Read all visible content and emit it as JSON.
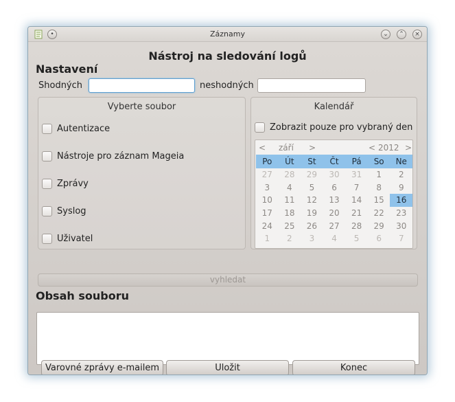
{
  "window": {
    "title": "Záznamy"
  },
  "main": {
    "heading": "Nástroj na sledování logů",
    "settings_title": "Nastavení",
    "match_label": "Shodných",
    "match_value": "",
    "nomatch_label": "neshodných",
    "nomatch_value": ""
  },
  "file_group": {
    "title": "Vyberte soubor",
    "items": [
      {
        "label": "Autentizace"
      },
      {
        "label": "Nástroje pro záznam Mageia"
      },
      {
        "label": "Zprávy"
      },
      {
        "label": "Syslog"
      },
      {
        "label": "Uživatel"
      }
    ]
  },
  "calendar_group": {
    "title": "Kalendář",
    "only_selected_label": "Zobrazit pouze pro vybraný den",
    "month": "září",
    "year": "2012",
    "prev": "<",
    "next": ">",
    "weekdays": [
      "Po",
      "Út",
      "St",
      "Čt",
      "Pá",
      "So",
      "Ne"
    ],
    "weeks": [
      [
        "27",
        "28",
        "29",
        "30",
        "31",
        "1",
        "2"
      ],
      [
        "3",
        "4",
        "5",
        "6",
        "7",
        "8",
        "9"
      ],
      [
        "10",
        "11",
        "12",
        "13",
        "14",
        "15",
        "16"
      ],
      [
        "17",
        "18",
        "19",
        "20",
        "21",
        "22",
        "23"
      ],
      [
        "24",
        "25",
        "26",
        "27",
        "28",
        "29",
        "30"
      ],
      [
        "1",
        "2",
        "3",
        "4",
        "5",
        "6",
        "7"
      ]
    ],
    "selected_day": "16"
  },
  "search_button": "vyhledat",
  "content_title": "Obsah souboru",
  "content_text": "",
  "buttons": {
    "email": "Varovné zprávy e-mailem",
    "save": "Uložit",
    "quit": "Konec"
  },
  "colors": {
    "accent": "#8fc2ea",
    "focus_border": "#5e9fd1"
  }
}
